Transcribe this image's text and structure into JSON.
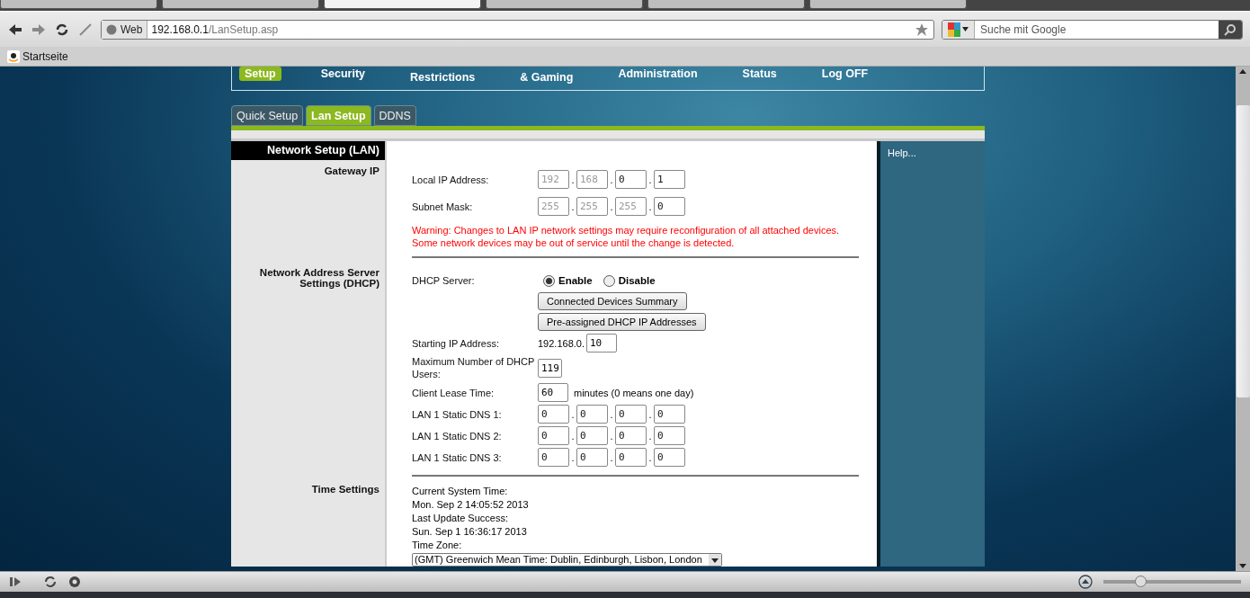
{
  "browser_tabs": [
    {
      "selected": false
    },
    {
      "selected": false
    },
    {
      "selected": true
    },
    {
      "selected": false
    },
    {
      "selected": false
    },
    {
      "selected": false
    }
  ],
  "address_bar": {
    "scheme_label": "Web",
    "host": "192.168.0.1",
    "path": "/LanSetup.asp"
  },
  "search": {
    "placeholder": "Suche mit Google"
  },
  "bookmarks": [
    {
      "label": "Startseite"
    }
  ],
  "router_nav": {
    "items": [
      {
        "label": "Setup",
        "selected": true
      },
      {
        "label": "Security",
        "selected": false
      },
      {
        "label": "Restrictions",
        "selected": false
      },
      {
        "label": "& Gaming",
        "selected": false
      },
      {
        "label": "Administration",
        "selected": false
      },
      {
        "label": "Status",
        "selected": false
      },
      {
        "label": "Log OFF",
        "selected": false
      }
    ]
  },
  "sub_tabs": [
    {
      "label": "Quick Setup",
      "selected": false
    },
    {
      "label": "Lan Setup",
      "selected": true
    },
    {
      "label": "DDNS",
      "selected": false
    }
  ],
  "page_title": "Network Setup (LAN)",
  "help_link": "Help...",
  "sections": [
    {
      "title": "Gateway IP",
      "rows": [
        {
          "kind": "ip",
          "label": "Local IP Address:",
          "separator": ".",
          "octets": [
            {
              "value": "192",
              "disabled": true
            },
            {
              "value": "168",
              "disabled": true
            },
            {
              "value": "0",
              "disabled": false
            },
            {
              "value": "1",
              "disabled": false
            }
          ]
        },
        {
          "kind": "ip",
          "label": "Subnet Mask:",
          "separator": ".",
          "octets": [
            {
              "value": "255",
              "disabled": true
            },
            {
              "value": "255",
              "disabled": true
            },
            {
              "value": "255",
              "disabled": true
            },
            {
              "value": "0",
              "disabled": false
            }
          ]
        },
        {
          "kind": "warning",
          "text": "Warning: Changes to LAN IP network settings may require reconfiguration of all attached devices. Some network devices may be out of service until the change is detected."
        }
      ]
    },
    {
      "title": "Network Address Server Settings (DHCP)",
      "rows": [
        {
          "kind": "radio",
          "label": "DHCP Server:",
          "options": [
            {
              "label": "Enable",
              "selected": true
            },
            {
              "label": "Disable",
              "selected": false
            }
          ]
        },
        {
          "kind": "button",
          "label": "Connected Devices Summary"
        },
        {
          "kind": "button",
          "label": "Pre-assigned DHCP IP Addresses"
        },
        {
          "kind": "prefixed",
          "label": "Starting IP Address:",
          "prefix": "192.168.0.",
          "value": "10"
        },
        {
          "kind": "text",
          "label": "Maximum Number of DHCP Users:",
          "value": "119"
        },
        {
          "kind": "text",
          "label": "Client Lease Time:",
          "value": "60",
          "suffix": "minutes (0 means one day)"
        },
        {
          "kind": "ip",
          "label": "LAN 1 Static DNS 1:",
          "separator": ".",
          "octets": [
            {
              "value": "0",
              "disabled": false
            },
            {
              "value": "0",
              "disabled": false
            },
            {
              "value": "0",
              "disabled": false
            },
            {
              "value": "0",
              "disabled": false
            }
          ]
        },
        {
          "kind": "ip",
          "label": "LAN 1 Static DNS 2:",
          "separator": ".",
          "octets": [
            {
              "value": "0",
              "disabled": false
            },
            {
              "value": "0",
              "disabled": false
            },
            {
              "value": "0",
              "disabled": false
            },
            {
              "value": "0",
              "disabled": false
            }
          ]
        },
        {
          "kind": "ip",
          "label": "LAN 1 Static DNS 3:",
          "separator": ".",
          "octets": [
            {
              "value": "0",
              "disabled": false
            },
            {
              "value": "0",
              "disabled": false
            },
            {
              "value": "0",
              "disabled": false
            },
            {
              "value": "0",
              "disabled": false
            }
          ]
        }
      ]
    },
    {
      "title": "Time Settings",
      "rows": [
        {
          "kind": "info",
          "text": "Current System Time:"
        },
        {
          "kind": "info",
          "text": "Mon. Sep 2 14:05:52 2013"
        },
        {
          "kind": "info",
          "text": "Last Update Success:"
        },
        {
          "kind": "info",
          "text": "Sun. Sep 1 16:36:17 2013"
        },
        {
          "kind": "info",
          "text": "Time Zone:"
        },
        {
          "kind": "select",
          "value": "(GMT) Greenwich Mean Time: Dublin, Edinburgh, Lisbon, London"
        }
      ]
    }
  ],
  "zoom_slider": {
    "level": 0.27
  }
}
